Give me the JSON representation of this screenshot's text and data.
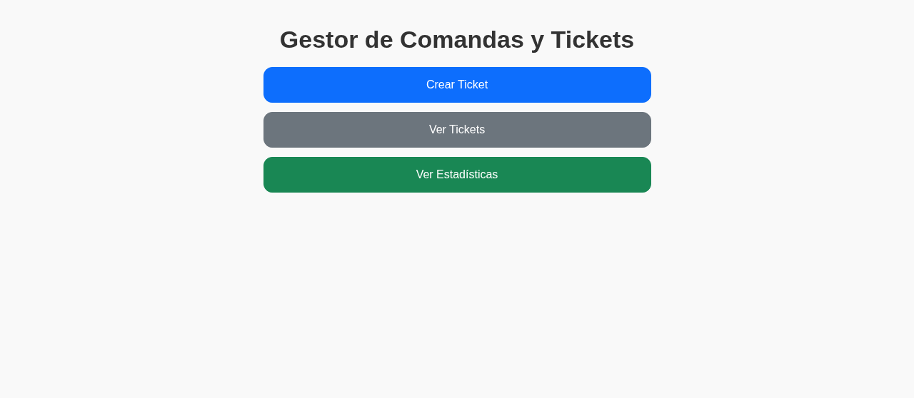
{
  "title": "Gestor de Comandas y Tickets",
  "buttons": [
    {
      "label": "Crear Ticket",
      "kind": "primary"
    },
    {
      "label": "Ver Tickets",
      "kind": "secondary"
    },
    {
      "label": "Ver Estadísticas",
      "kind": "success"
    }
  ]
}
